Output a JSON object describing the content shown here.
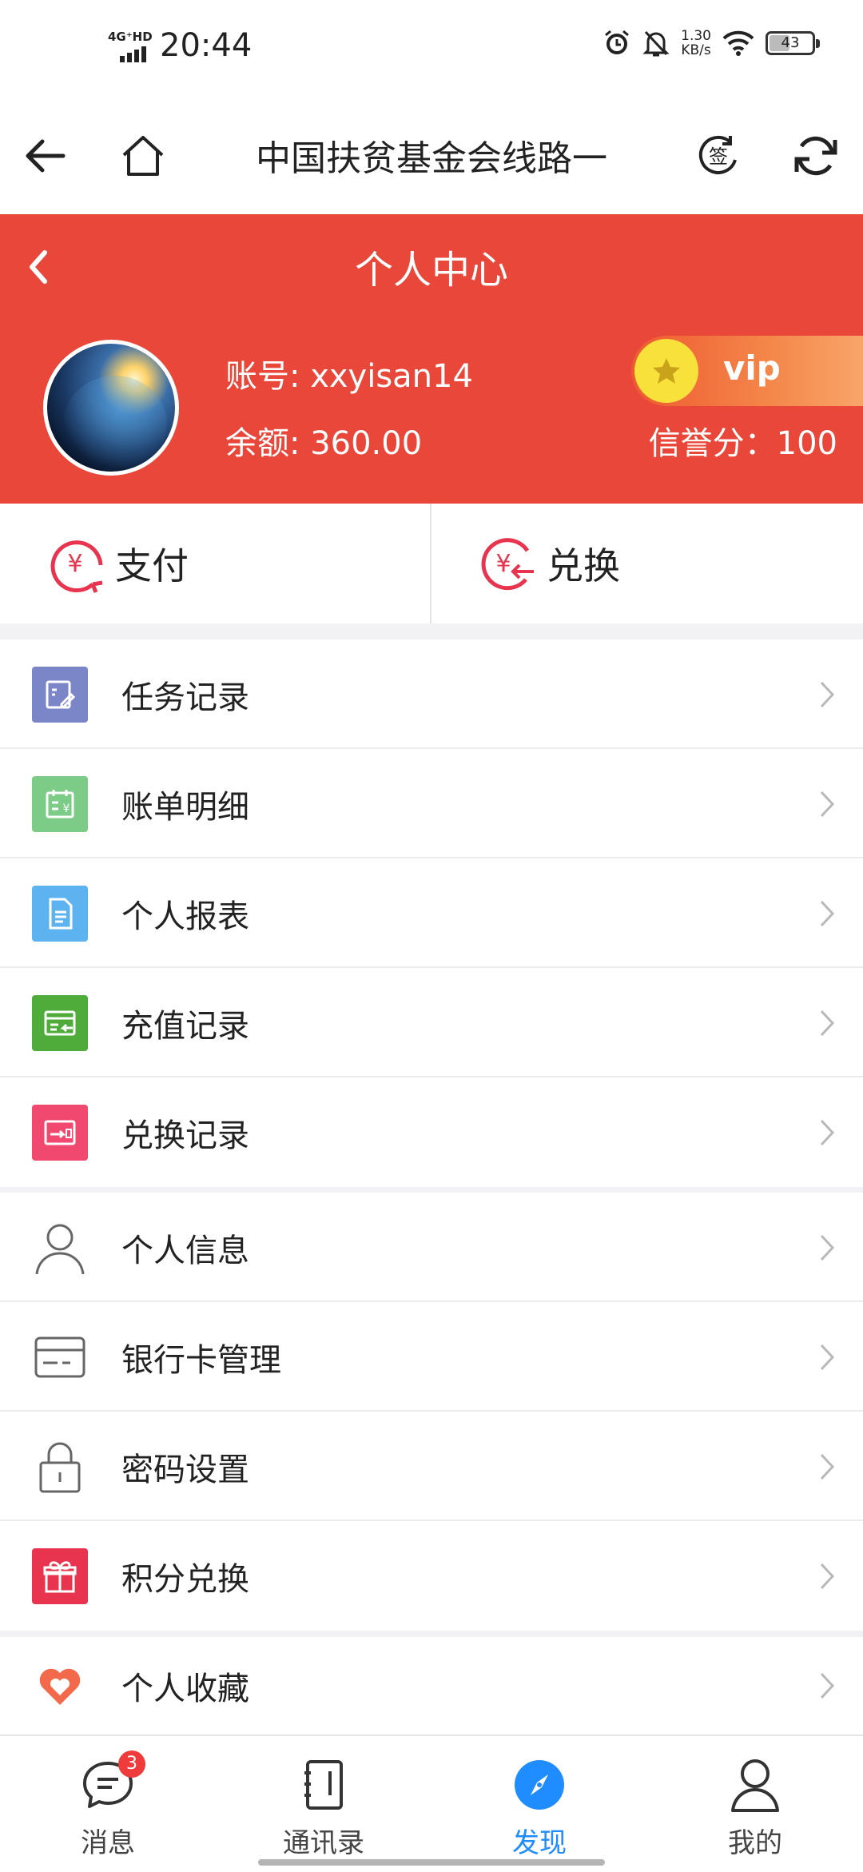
{
  "status_bar": {
    "network": "4G⁺HD",
    "time": "20:44",
    "speed_value": "1.30",
    "speed_unit": "KB/s",
    "battery": "43"
  },
  "app_bar": {
    "title": "中国扶贫基金会线路一",
    "sign_icon_text": "签"
  },
  "header": {
    "title": "个人中心",
    "account_label": "账号: xxyisan14",
    "balance_label": "余额: 360.00",
    "credit_label": "信誉分：100",
    "vip_label": "vip"
  },
  "actions": {
    "pay": "支付",
    "exchange": "兑换"
  },
  "group1": [
    {
      "label": "任务记录",
      "icon": "task-record-icon",
      "color": "#7b86c9"
    },
    {
      "label": "账单明细",
      "icon": "bill-detail-icon",
      "color": "#7ccb86"
    },
    {
      "label": "个人报表",
      "icon": "report-icon",
      "color": "#5db3f0"
    },
    {
      "label": "充值记录",
      "icon": "recharge-record-icon",
      "color": "#4fac3a"
    },
    {
      "label": "兑换记录",
      "icon": "exchange-record-icon",
      "color": "#f0486e"
    }
  ],
  "group2": [
    {
      "label": "个人信息",
      "icon": "user-icon"
    },
    {
      "label": "银行卡管理",
      "icon": "bank-card-icon"
    },
    {
      "label": "密码设置",
      "icon": "lock-icon"
    },
    {
      "label": "积分兑换",
      "icon": "gift-icon",
      "color": "#e8344e"
    }
  ],
  "group3": [
    {
      "label": "个人收藏",
      "icon": "heart-icon",
      "color": "#f26a4b"
    }
  ],
  "tabs": [
    {
      "label": "消息",
      "badge": "3"
    },
    {
      "label": "通讯录"
    },
    {
      "label": "发现"
    },
    {
      "label": "我的"
    }
  ],
  "colors": {
    "header_red": "#e8473a",
    "active_blue": "#1f8cff"
  }
}
